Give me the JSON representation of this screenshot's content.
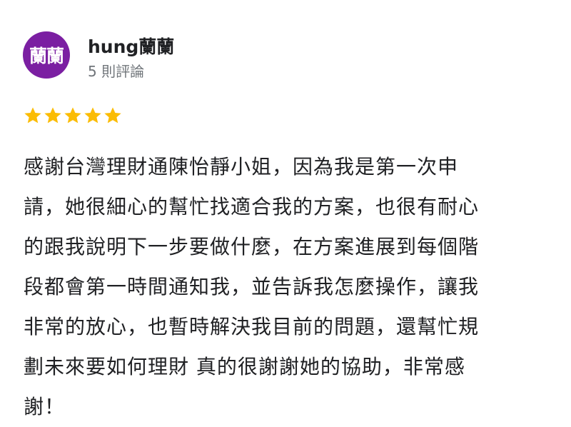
{
  "reviewer": {
    "avatar_text": "蘭蘭",
    "avatar_color": "#7b1fa2",
    "name": "hung蘭蘭",
    "review_count": "5 則評論"
  },
  "rating": {
    "stars": 5,
    "max": 5,
    "star_color": "#fbbc04",
    "icon": "star-icon"
  },
  "review": {
    "lines": [
      "感謝台灣理財通陳怡靜小姐，因為我是第一次申",
      "請，她很細心的幫忙找適合我的方案，也很有耐心",
      "的跟我說明下一步要做什麼，在方案進展到每個階",
      "段都會第一時間通知我，並告訴我怎麼操作，讓我",
      "非常的放心，也暫時解決我目前的問題，還幫忙規",
      "劃未來要如何理財 真的很謝謝她的協助，非常感",
      "謝！"
    ]
  }
}
